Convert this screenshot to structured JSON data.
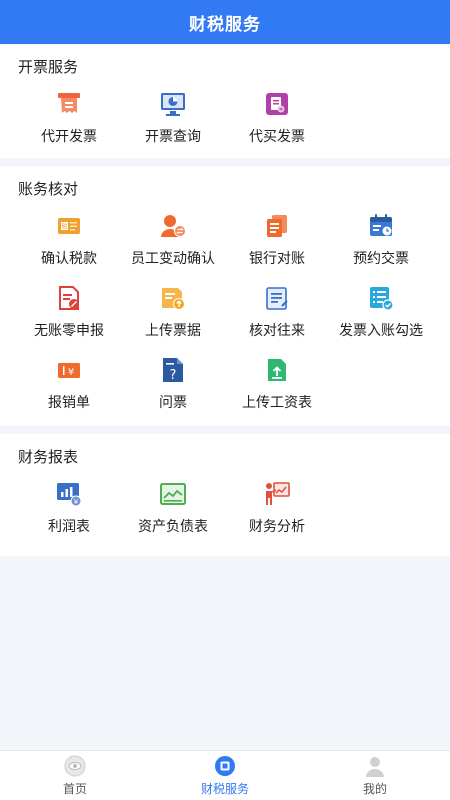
{
  "header": {
    "title": "财税服务"
  },
  "sections": [
    {
      "title": "开票服务",
      "items": [
        {
          "label": "代开发票",
          "icon": "invoice-issue-icon",
          "color": "#f0643c"
        },
        {
          "label": "开票查询",
          "icon": "invoice-query-icon",
          "color": "#3a6ec9"
        },
        {
          "label": "代买发票",
          "icon": "invoice-buy-icon",
          "color": "#b040a8"
        }
      ]
    },
    {
      "title": "账务核对",
      "items": [
        {
          "label": "确认税款",
          "icon": "tax-confirm-icon",
          "color": "#f0a030"
        },
        {
          "label": "员工变动确认",
          "icon": "employee-change-icon",
          "color": "#f06a2e"
        },
        {
          "label": "银行对账",
          "icon": "bank-reconcile-icon",
          "color": "#f06a2e"
        },
        {
          "label": "预约交票",
          "icon": "appointment-calendar-icon",
          "color": "#3a78d8"
        },
        {
          "label": "无账零申报",
          "icon": "zero-declaration-icon",
          "color": "#e0403c"
        },
        {
          "label": "上传票据",
          "icon": "upload-bill-icon",
          "color": "#f5a623"
        },
        {
          "label": "核对往来",
          "icon": "check-accounts-icon",
          "color": "#3a6ec9"
        },
        {
          "label": "发票入账勾选",
          "icon": "invoice-select-icon",
          "color": "#2aa8dc"
        },
        {
          "label": "报销单",
          "icon": "reimbursement-icon",
          "color": "#f06a2e"
        },
        {
          "label": "问票",
          "icon": "ask-invoice-icon",
          "color": "#2c5aa0"
        },
        {
          "label": "上传工资表",
          "icon": "upload-payroll-icon",
          "color": "#2eb872"
        }
      ]
    },
    {
      "title": "财务报表",
      "items": [
        {
          "label": "利润表",
          "icon": "profit-chart-icon",
          "color": "#3a6ec9"
        },
        {
          "label": "资产负债表",
          "icon": "balance-sheet-icon",
          "color": "#4caf50"
        },
        {
          "label": "财务分析",
          "icon": "financial-analysis-icon",
          "color": "#e0503c"
        }
      ]
    }
  ],
  "tabbar": {
    "tabs": [
      {
        "label": "首页",
        "icon": "home-icon",
        "active": false
      },
      {
        "label": "财税服务",
        "icon": "tax-service-icon",
        "active": true
      },
      {
        "label": "我的",
        "icon": "profile-icon",
        "active": false
      }
    ]
  }
}
